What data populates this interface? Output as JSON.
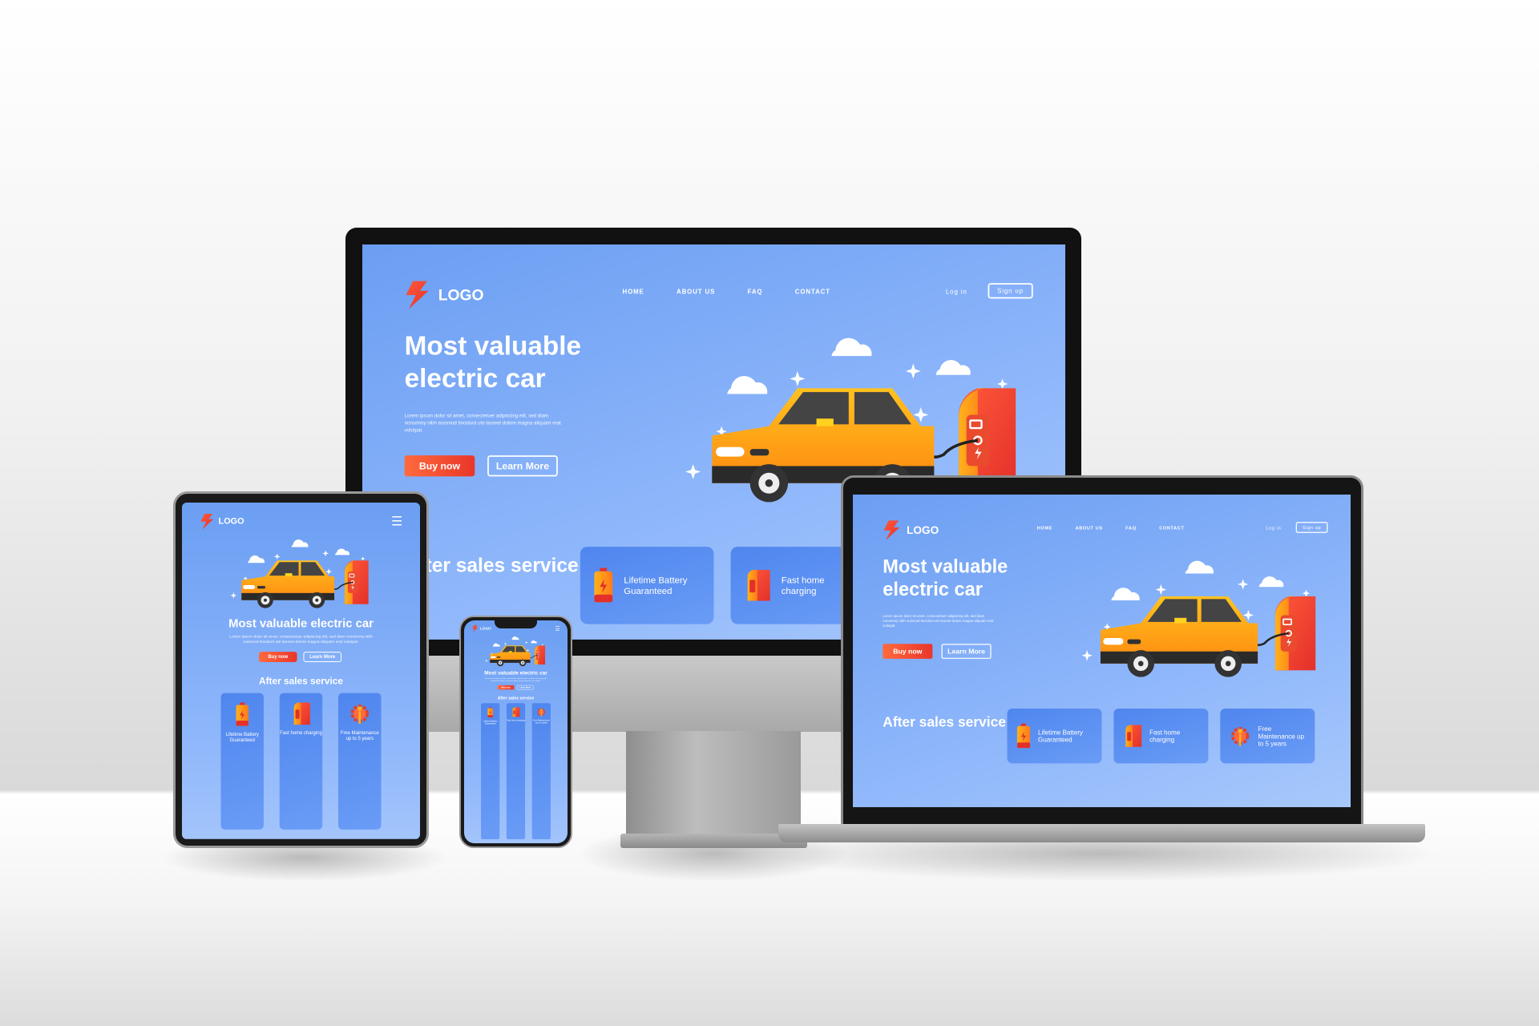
{
  "site": {
    "logo_text": "LOGO",
    "nav": [
      "HOME",
      "ABOUT US",
      "FAQ",
      "CONTACT"
    ],
    "login": "Log in",
    "signup": "Sign up",
    "menu_icon": "hamburger-menu-icon",
    "hero_title": "Most valuable electric car",
    "hero_body": "Lorem ipsum dolor sit amet, consectetuer adipiscing elit, sed diam nonummy nibh euismod tincidunt ute laoreet dolore magna aliquam erat volutpat.",
    "buy_now": "Buy now",
    "learn_more": "Learn More",
    "after_sales_title": "After sales service",
    "cards": [
      {
        "label": "Lifetime Battery Guaranteed",
        "icon": "battery-icon"
      },
      {
        "label": "Fast home charging",
        "icon": "charger-icon"
      },
      {
        "label": "Free Maintenance up to 5 years",
        "icon": "gear-wrench-icon"
      }
    ]
  },
  "colors": {
    "page_blue": "#6b9ef2",
    "card_blue": "#4f86ee",
    "accent_orange": "#ff6a3d",
    "car_yellow": "#ffb51a"
  }
}
